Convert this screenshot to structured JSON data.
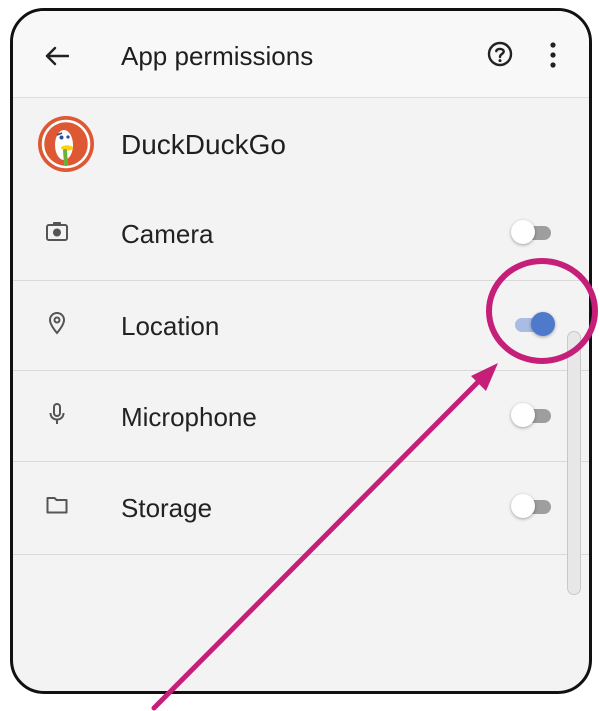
{
  "appbar": {
    "title": "App permissions",
    "back_icon": "arrow-left-icon",
    "help_icon": "help-circle-icon",
    "more_icon": "more-vert-icon"
  },
  "app": {
    "name": "DuckDuckGo",
    "logo_icon": "duckduckgo-logo"
  },
  "permissions": [
    {
      "label": "Camera",
      "icon": "camera-icon",
      "enabled": false
    },
    {
      "label": "Location",
      "icon": "location-pin-icon",
      "enabled": true
    },
    {
      "label": "Microphone",
      "icon": "microphone-icon",
      "enabled": false
    },
    {
      "label": "Storage",
      "icon": "folder-icon",
      "enabled": false
    }
  ],
  "colors": {
    "switch_on_thumb": "#4f79cb",
    "switch_on_track": "#a9bce4",
    "switch_off_track": "#9e9e9e",
    "annotation": "#c51f7a"
  }
}
